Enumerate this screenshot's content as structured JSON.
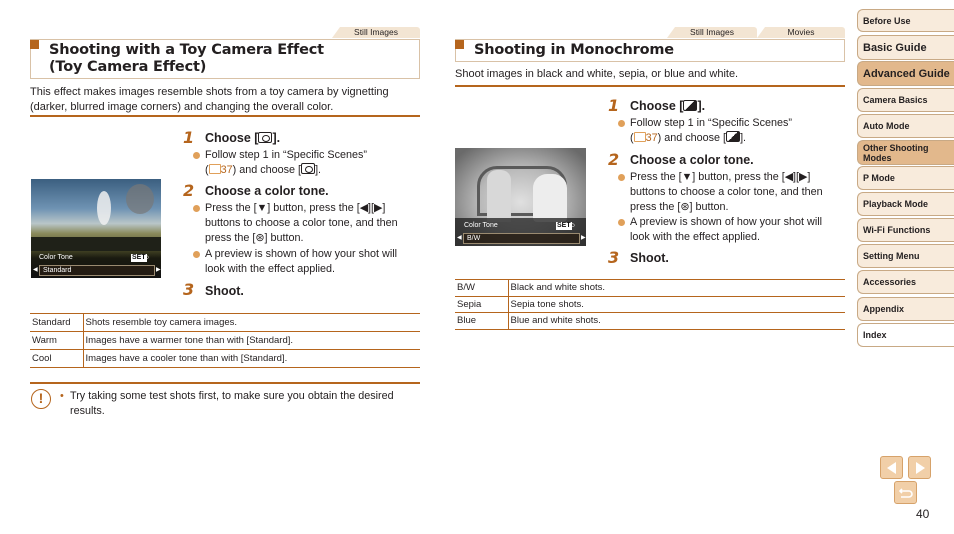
{
  "left_section": {
    "tabs": [
      "Still Images"
    ],
    "title_line1": "Shooting with a Toy Camera Effect",
    "title_line2": "(Toy Camera Effect)",
    "intro_line1": "This effect makes images resemble shots from a toy camera by vignetting",
    "intro_line2": "(darker, blurred image corners) and changing the overall color.",
    "steps": [
      {
        "num": "1",
        "title_pre": "Choose [",
        "title_post": "].",
        "bullets": [
          {
            "l1": "Follow step 1 in “Specific Scenes”",
            "l2_pre": "(",
            "ref": "37",
            "l2_mid": ") and choose [",
            "l2_post": "]."
          }
        ]
      },
      {
        "num": "2",
        "title": "Choose a color tone.",
        "bullets": [
          {
            "l1_pre": "Press the [",
            "l1_mid": "] button, press the [",
            "l1_post": "]",
            "l2": "buttons to choose a color tone, and then",
            "l3_pre": "press the [",
            "l3_post": "] button."
          },
          {
            "l1": "A preview is shown of how your shot will",
            "l2": "look with the effect applied."
          }
        ]
      },
      {
        "num": "3",
        "title": "Shoot."
      }
    ],
    "screen": {
      "label": "Color Tone",
      "set": "SET",
      "value": "Standard",
      "icon": "train-photo"
    },
    "table": [
      {
        "key": "Standard",
        "desc": "Shots resemble toy camera images."
      },
      {
        "key": "Warm",
        "desc": "Images have a warmer tone than with [Standard]."
      },
      {
        "key": "Cool",
        "desc": "Images have a cooler tone than with [Standard]."
      }
    ],
    "caution": {
      "icon": "!",
      "line1": "Try taking some test shots first, to make sure you obtain the desired",
      "line2": "results."
    }
  },
  "right_section": {
    "tabs": [
      "Still Images",
      "Movies"
    ],
    "title": "Shooting in Monochrome",
    "intro": "Shoot images in black and white, sepia, or blue and white.",
    "steps": [
      {
        "num": "1",
        "title_pre": "Choose [",
        "title_post": "].",
        "bullets": [
          {
            "l1": "Follow step 1 in “Specific Scenes”",
            "l2_pre": "(",
            "ref": "37",
            "l2_mid": ") and choose [",
            "l2_post": "]."
          }
        ]
      },
      {
        "num": "2",
        "title": "Choose a color tone.",
        "bullets": [
          {
            "l1_pre": "Press the [",
            "l1_mid": "] button, press the [",
            "l1_post": "]",
            "l2": "buttons to choose a color tone, and then",
            "l3_pre": "press the [",
            "l3_post": "] button."
          },
          {
            "l1": "A preview is shown of how your shot will",
            "l2": "look with the effect applied."
          }
        ]
      },
      {
        "num": "3",
        "title": "Shoot."
      }
    ],
    "screen": {
      "label": "Color Tone",
      "set": "SET",
      "value": "B/W",
      "icon": "children-photo"
    },
    "table": [
      {
        "key": "B/W",
        "desc": "Black and white shots."
      },
      {
        "key": "Sepia",
        "desc": "Sepia tone shots."
      },
      {
        "key": "Blue",
        "desc": "Blue and white shots."
      }
    ]
  },
  "sidebar": {
    "items": [
      {
        "label": "Before Use"
      },
      {
        "label": "Basic Guide"
      },
      {
        "label": "Advanced Guide"
      },
      {
        "label": "Camera Basics"
      },
      {
        "label": "Auto Mode"
      },
      {
        "label": "Other Shooting Modes"
      },
      {
        "label": "P Mode"
      },
      {
        "label": "Playback Mode"
      },
      {
        "label": "Wi-Fi Functions"
      },
      {
        "label": "Setting Menu"
      },
      {
        "label": "Accessories"
      },
      {
        "label": "Appendix"
      },
      {
        "label": "Index"
      }
    ]
  },
  "nav": {
    "prev": "prev-page",
    "next": "next-page",
    "back": "return"
  },
  "page_number": "40",
  "colors": {
    "accent": "#b5651d",
    "tab_bg": "#f3e5d3",
    "sidebar_bg": "#f8ebdc",
    "sidebar_active": "#e2b88c",
    "bullet": "#e0a05a"
  }
}
